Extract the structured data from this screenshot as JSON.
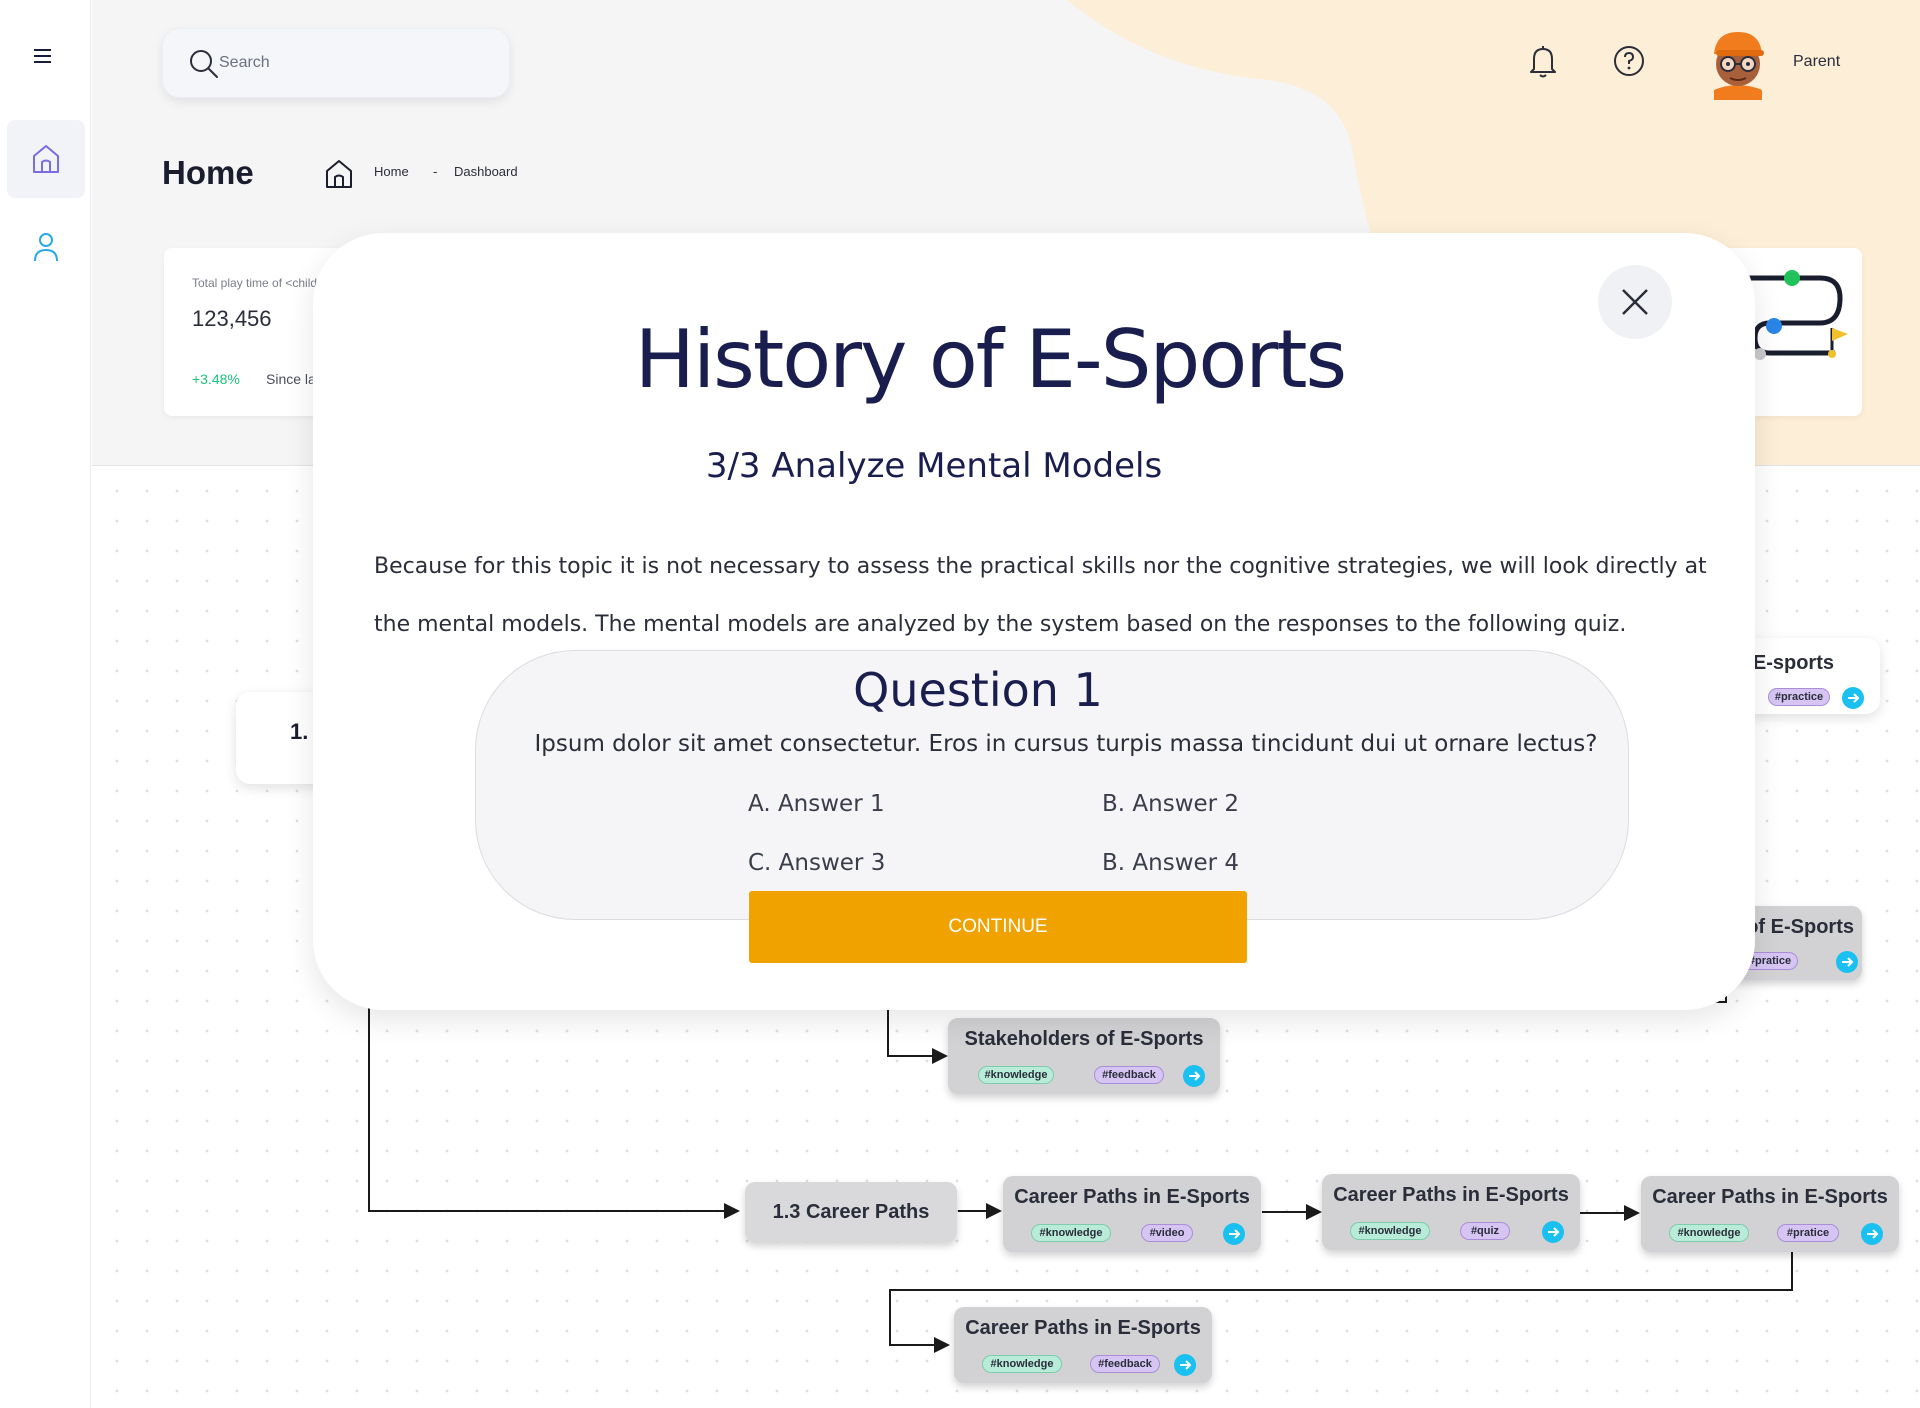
{
  "search": {
    "placeholder": "Search"
  },
  "header": {
    "user_name": "Parent"
  },
  "page": {
    "title": "Home"
  },
  "breadcrumb": {
    "home": "Home",
    "separator": "-",
    "current": "Dashboard"
  },
  "stat_card": {
    "label": "Total play time of <child>",
    "value": "123,456",
    "change": "+3.48%",
    "since": "Since last month"
  },
  "flow": {
    "partial_node_label": "1.",
    "career_node": "1.3 Career Paths",
    "nodes": [
      {
        "title": "Stakeholders of E-Sports",
        "tags": [
          "#knowledge",
          "#feedback"
        ]
      },
      {
        "title": "Career Paths in E-Sports",
        "tags": [
          "#knowledge",
          "#video"
        ]
      },
      {
        "title": "Career Paths in E-Sports",
        "tags": [
          "#knowledge",
          "#quiz"
        ]
      },
      {
        "title": "Career Paths in E-Sports",
        "tags": [
          "#knowledge",
          "#pratice"
        ]
      },
      {
        "title": "Career Paths in E-Sports",
        "tags": [
          "#knowledge",
          "#feedback"
        ]
      },
      {
        "title": "E-sports",
        "tags": [
          "#practice"
        ]
      },
      {
        "title": "of E-Sports",
        "tags": [
          "#pratice"
        ]
      }
    ]
  },
  "modal": {
    "title": "History of E-Sports",
    "subtitle": "3/3 Analyze Mental Models",
    "body": "Because for this topic it is not necessary to assess the practical skills nor the cognitive strategies, we will look directly at the mental models. The mental models are analyzed by the system based on the responses to the following quiz.",
    "question_title": "Question 1",
    "question_text": "Ipsum dolor sit amet consectetur. Eros in cursus turpis massa tincidunt dui ut ornare lectus?",
    "answers": [
      "A. Answer 1",
      "B. Answer 2",
      "C. Answer 3",
      "B. Answer 4"
    ],
    "continue_label": "CONTINUE"
  },
  "colors": {
    "accent": "#f0a300",
    "title_navy": "#1a1e4e",
    "go_button": "#1ac0ef",
    "positive": "#19c37d",
    "peach": "#fdeed7"
  },
  "icons": [
    "menu-icon",
    "home-icon",
    "user-icon",
    "search-icon",
    "bell-icon",
    "help-icon",
    "close-icon",
    "arrow-right-icon"
  ]
}
